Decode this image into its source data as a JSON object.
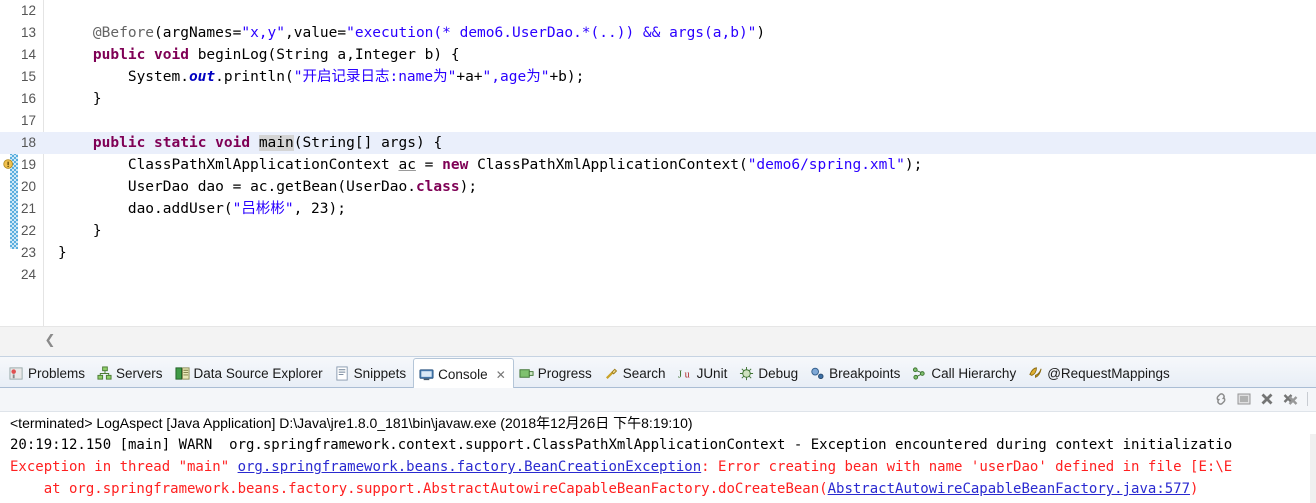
{
  "editor": {
    "lines": [
      {
        "num": "12",
        "segments": []
      },
      {
        "num": "13",
        "segments": [
          {
            "t": "    ",
            "c": "plain"
          },
          {
            "t": "@Before",
            "c": "ann"
          },
          {
            "t": "(argNames=",
            "c": "plain"
          },
          {
            "t": "\"x,y\"",
            "c": "str"
          },
          {
            "t": ",value=",
            "c": "plain"
          },
          {
            "t": "\"execution(* demo6.UserDao.*(..)) && args(a,b)\"",
            "c": "str"
          },
          {
            "t": ")",
            "c": "plain"
          }
        ]
      },
      {
        "num": "14",
        "segments": [
          {
            "t": "    ",
            "c": "plain"
          },
          {
            "t": "public",
            "c": "kw"
          },
          {
            "t": " ",
            "c": "plain"
          },
          {
            "t": "void",
            "c": "kw"
          },
          {
            "t": " beginLog(String a,Integer b) {",
            "c": "plain"
          }
        ]
      },
      {
        "num": "15",
        "segments": [
          {
            "t": "        System.",
            "c": "plain"
          },
          {
            "t": "out",
            "c": "fld"
          },
          {
            "t": ".println(",
            "c": "plain"
          },
          {
            "t": "\"开启记录日志:name为\"",
            "c": "str"
          },
          {
            "t": "+a+",
            "c": "plain"
          },
          {
            "t": "\",age为\"",
            "c": "str"
          },
          {
            "t": "+b);",
            "c": "plain"
          }
        ]
      },
      {
        "num": "16",
        "segments": [
          {
            "t": "    }",
            "c": "plain"
          }
        ]
      },
      {
        "num": "17",
        "segments": []
      },
      {
        "num": "18",
        "highlight": true,
        "segments": [
          {
            "t": "    ",
            "c": "plain"
          },
          {
            "t": "public",
            "c": "kw"
          },
          {
            "t": " ",
            "c": "plain"
          },
          {
            "t": "static",
            "c": "kw"
          },
          {
            "t": " ",
            "c": "plain"
          },
          {
            "t": "void",
            "c": "kw"
          },
          {
            "t": " ",
            "c": "plain"
          },
          {
            "t": "main",
            "c": "sel"
          },
          {
            "t": "(String[] ",
            "c": "plain"
          },
          {
            "t": "args",
            "c": "plain"
          },
          {
            "t": ") {",
            "c": "plain"
          }
        ]
      },
      {
        "num": "19",
        "warning": true,
        "segments": [
          {
            "t": "        ClassPathXmlApplicationContext ",
            "c": "plain"
          },
          {
            "t": "ac",
            "c": "loc"
          },
          {
            "t": " = ",
            "c": "plain"
          },
          {
            "t": "new",
            "c": "kw"
          },
          {
            "t": " ClassPathXmlApplicationContext(",
            "c": "plain"
          },
          {
            "t": "\"demo6/spring.xml\"",
            "c": "str"
          },
          {
            "t": ");",
            "c": "plain"
          }
        ]
      },
      {
        "num": "20",
        "segments": [
          {
            "t": "        UserDao ",
            "c": "plain"
          },
          {
            "t": "dao",
            "c": "plain"
          },
          {
            "t": " = ac.getBean(UserDao.",
            "c": "plain"
          },
          {
            "t": "class",
            "c": "kw"
          },
          {
            "t": ");",
            "c": "plain"
          }
        ]
      },
      {
        "num": "21",
        "segments": [
          {
            "t": "        dao.addUser(",
            "c": "plain"
          },
          {
            "t": "\"吕彬彬\"",
            "c": "str"
          },
          {
            "t": ", 23);",
            "c": "plain"
          }
        ]
      },
      {
        "num": "22",
        "segments": [
          {
            "t": "    }",
            "c": "plain"
          }
        ]
      },
      {
        "num": "23",
        "segments": [
          {
            "t": "}",
            "c": "plain"
          }
        ]
      },
      {
        "num": "24",
        "segments": []
      }
    ],
    "collapse_arrow": "❮"
  },
  "tabs": [
    {
      "label": "Problems",
      "icon": "problems-icon",
      "active": false,
      "closable": false
    },
    {
      "label": "Servers",
      "icon": "servers-icon",
      "active": false,
      "closable": false
    },
    {
      "label": "Data Source Explorer",
      "icon": "data-source-icon",
      "active": false,
      "closable": false
    },
    {
      "label": "Snippets",
      "icon": "snippets-icon",
      "active": false,
      "closable": false
    },
    {
      "label": "Console",
      "icon": "console-icon",
      "active": true,
      "closable": true
    },
    {
      "label": "Progress",
      "icon": "progress-icon",
      "active": false,
      "closable": false
    },
    {
      "label": "Search",
      "icon": "search-icon",
      "active": false,
      "closable": false
    },
    {
      "label": "JUnit",
      "icon": "junit-icon",
      "active": false,
      "closable": false
    },
    {
      "label": "Debug",
      "icon": "debug-icon",
      "active": false,
      "closable": false
    },
    {
      "label": "Breakpoints",
      "icon": "breakpoints-icon",
      "active": false,
      "closable": false
    },
    {
      "label": "Call Hierarchy",
      "icon": "call-hierarchy-icon",
      "active": false,
      "closable": false
    },
    {
      "label": "@RequestMappings",
      "icon": "request-mappings-icon",
      "active": false,
      "closable": false
    }
  ],
  "tab_close_glyph": "✕",
  "console": {
    "toolbar_icons": [
      "link-with-debug-icon",
      "display-selected-console-icon",
      "terminate-icon",
      "remove-all-terminated-icon"
    ],
    "title": "<terminated> LogAspect [Java Application] D:\\Java\\jre1.8.0_181\\bin\\javaw.exe (2018年12月26日 下午8:19:10)",
    "lines": [
      {
        "kind": "out",
        "parts": [
          {
            "t": "20:19:12.150 [main] WARN  org.springframework.context.support.ClassPathXmlApplicationContext - Exception encountered during context initializatio",
            "link": false
          }
        ]
      },
      {
        "kind": "err",
        "parts": [
          {
            "t": "Exception in thread \"main\" ",
            "link": false
          },
          {
            "t": "org.springframework.beans.factory.BeanCreationException",
            "link": true
          },
          {
            "t": ": Error creating bean with name 'userDao' defined in file [E:\\E",
            "link": false
          }
        ]
      },
      {
        "kind": "err",
        "parts": [
          {
            "t": "    at org.springframework.beans.factory.support.AbstractAutowireCapableBeanFactory.doCreateBean(",
            "link": false
          },
          {
            "t": "AbstractAutowireCapableBeanFactory.java:577",
            "link": true
          },
          {
            "t": ")",
            "link": false
          }
        ]
      }
    ]
  },
  "colors": {
    "keyword": "#7f0055",
    "string": "#2a00ff",
    "annotation": "#646464",
    "field": "#0000c0",
    "error": "#ff2020",
    "link": "#2a2ad0",
    "highlight_row": "#eaeffb",
    "change_bar": "#5aaede"
  }
}
